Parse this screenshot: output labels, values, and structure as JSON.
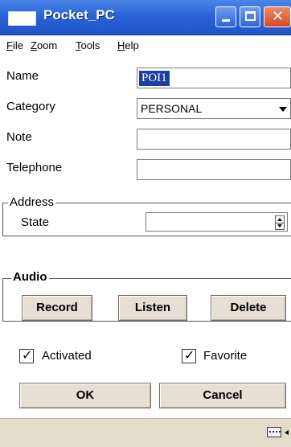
{
  "window": {
    "title": "Pocket_PC",
    "title_icon": "window-app-icon",
    "buttons": [
      "minimize-icon",
      "maximize-icon",
      "close-icon"
    ],
    "colors": {
      "titlebar": "#2a63d6",
      "close_button": "#d7491f",
      "status_bar": "#e3dccb",
      "button_face": "#e7ded4"
    }
  },
  "menu": [
    {
      "label": "File",
      "mnemonic": "F"
    },
    {
      "label": "Zoom",
      "mnemonic": "Z"
    },
    {
      "label": "Tools",
      "mnemonic": "T"
    },
    {
      "label": "Help",
      "mnemonic": "H"
    }
  ],
  "form": {
    "name": {
      "label": "Name",
      "value": "POI1"
    },
    "category": {
      "label": "Category",
      "value": "PERSONAL"
    },
    "note": {
      "label": "Note",
      "value": ""
    },
    "telephone": {
      "label": "Telephone",
      "value": ""
    }
  },
  "address": {
    "title": "Address",
    "state": {
      "label": "State",
      "value": ""
    }
  },
  "audio": {
    "title": "Audio",
    "record_label": "Record",
    "listen_label": "Listen",
    "delete_label": "Delete"
  },
  "options": {
    "activated": {
      "label": "Activated",
      "checked": true
    },
    "favorite": {
      "label": "Favorite",
      "checked": true
    }
  },
  "actions": {
    "ok_label": "OK",
    "cancel_label": "Cancel"
  },
  "status_bar": {
    "input_icon": "keyboard-icon"
  }
}
